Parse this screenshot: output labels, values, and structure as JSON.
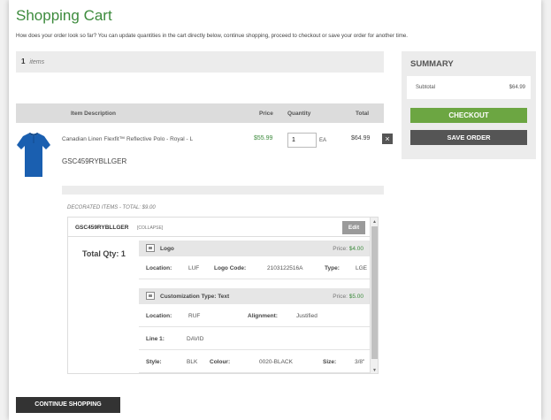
{
  "page": {
    "title": "Shopping Cart",
    "intro": "How does your order look so far? You can update quantities in the cart directly below, continue shopping, proceed to checkout or save your order for another time."
  },
  "cart": {
    "item_count": "1",
    "items_label": "items",
    "headers": {
      "description": "Item Description",
      "price": "Price",
      "quantity": "Quantity",
      "total": "Total"
    },
    "item": {
      "name": "Canadian Linen Flexfit™ Reflective Polo - Royal - L",
      "sku": "GSC459RYBLLGER",
      "price": "$55.99",
      "quantity": "1",
      "unit": "EA",
      "total": "$64.99",
      "remove_icon": "×",
      "color": "#1a5fb0"
    }
  },
  "decorated": {
    "title": "DECORATED ITEMS - TOTAL: $9.00",
    "sku": "GSC459RYBLLGER",
    "collapse_label": "[COLLAPSE]",
    "edit_label": "Edit",
    "total_qty": "Total Qty: 1",
    "logo": {
      "label": "Logo",
      "price_label": "Price:",
      "price": "$4.00",
      "location_label": "Location:",
      "location": "LUF",
      "code_label": "Logo Code:",
      "code": "2103122516A",
      "type_label": "Type:",
      "type": "LGE"
    },
    "customization": {
      "label": "Customization Type: Text",
      "price_label": "Price:",
      "price": "$5.00",
      "location_label": "Location:",
      "location": "RUF",
      "alignment_label": "Alignment:",
      "alignment": "Justified",
      "line1_label": "Line 1:",
      "line1": "DAVID",
      "style_label": "Style:",
      "style": "BLK",
      "colour_label": "Colour:",
      "colour": "0020-BLACK",
      "size_label": "Size:",
      "size": "3/8\""
    }
  },
  "summary": {
    "title": "SUMMARY",
    "subtotal_label": "Subtotal",
    "subtotal": "$64.99",
    "checkout_label": "CHECKOUT",
    "save_label": "SAVE ORDER"
  },
  "actions": {
    "continue_label": "CONTINUE SHOPPING"
  },
  "colors": {
    "accent": "#3d8b3d",
    "checkout": "#6ca642",
    "dark_button": "#333333"
  }
}
